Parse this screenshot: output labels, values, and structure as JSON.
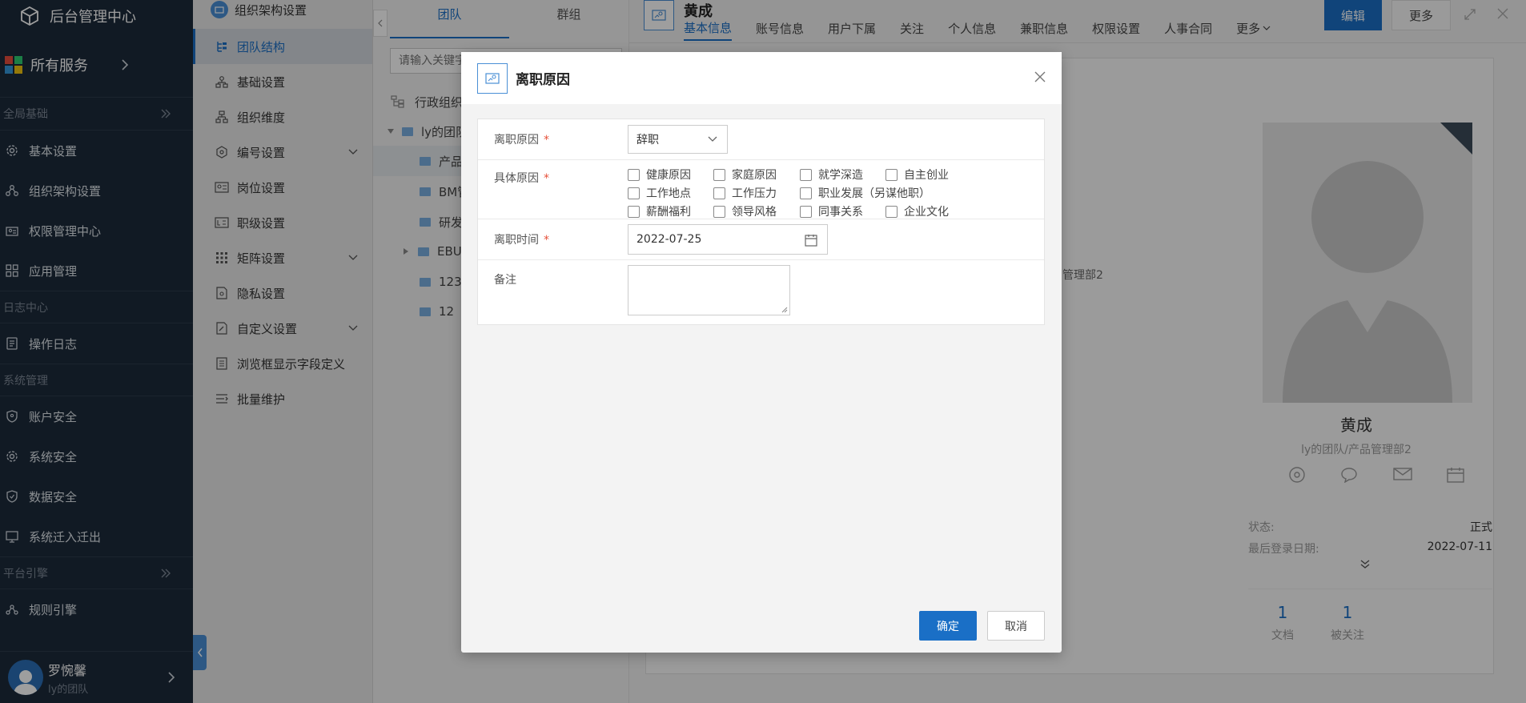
{
  "sidebar": {
    "brand": "后台管理中心",
    "services": "所有服务",
    "sections": [
      {
        "title": "全局基础"
      },
      {
        "title": "日志中心"
      },
      {
        "title": "系统管理"
      },
      {
        "title": "平台引擎"
      }
    ],
    "items_global": [
      "基本设置",
      "组织架构设置",
      "权限管理中心",
      "应用管理"
    ],
    "items_log": [
      "操作日志"
    ],
    "items_system": [
      "账户安全",
      "系统安全",
      "数据安全",
      "系统迁入迁出"
    ],
    "items_engine": [
      "规则引擎"
    ],
    "user": {
      "name": "罗惋馨",
      "team": "ly的团队"
    }
  },
  "submenu": {
    "header": "组织架构设置",
    "items": [
      "团队结构",
      "基础设置",
      "组织维度",
      "编号设置",
      "岗位设置",
      "职级设置",
      "矩阵设置",
      "隐私设置",
      "自定义设置",
      "浏览框显示字段定义",
      "批量维护"
    ]
  },
  "tree": {
    "tabs": [
      "团队",
      "群组"
    ],
    "search_placeholder": "请输入关键字",
    "root_label": "行政组织",
    "nodes": [
      "ly的团队",
      "产品",
      "BM管",
      "研发",
      "EBU",
      "123",
      "12"
    ]
  },
  "main": {
    "name": "黄成",
    "tabs": [
      "基本信息",
      "账号信息",
      "用户下属",
      "关注",
      "个人信息",
      "兼职信息",
      "权限设置",
      "人事合同",
      "更多"
    ],
    "edit_label": "编辑",
    "more_label": "更多",
    "bg_dept": "管理部2",
    "profile": {
      "name": "黄成",
      "team": "ly的团队/产品管理部2",
      "status_label": "状态:",
      "status_value": "正式",
      "login_label": "最后登录日期:",
      "login_value": "2022-07-11",
      "docs_count": "1",
      "docs_label": "文档",
      "followers_count": "1",
      "followers_label": "被关注"
    }
  },
  "modal": {
    "title": "离职原因",
    "fields": {
      "reason_label": "离职原因",
      "reason_value": "辞职",
      "detail_label": "具体原因",
      "detail_options": [
        "健康原因",
        "家庭原因",
        "就学深造",
        "自主创业",
        "工作地点",
        "工作压力",
        "职业发展（另谋他职）",
        "薪酬福利",
        "领导风格",
        "同事关系",
        "企业文化"
      ],
      "date_label": "离职时间",
      "date_value": "2022-07-25",
      "note_label": "备注"
    },
    "ok_label": "确定",
    "cancel_label": "取消"
  },
  "colors": {
    "accent": "#1a6fc6",
    "sidebar_bg": "#1c2a3a",
    "required": "#e6513a"
  }
}
